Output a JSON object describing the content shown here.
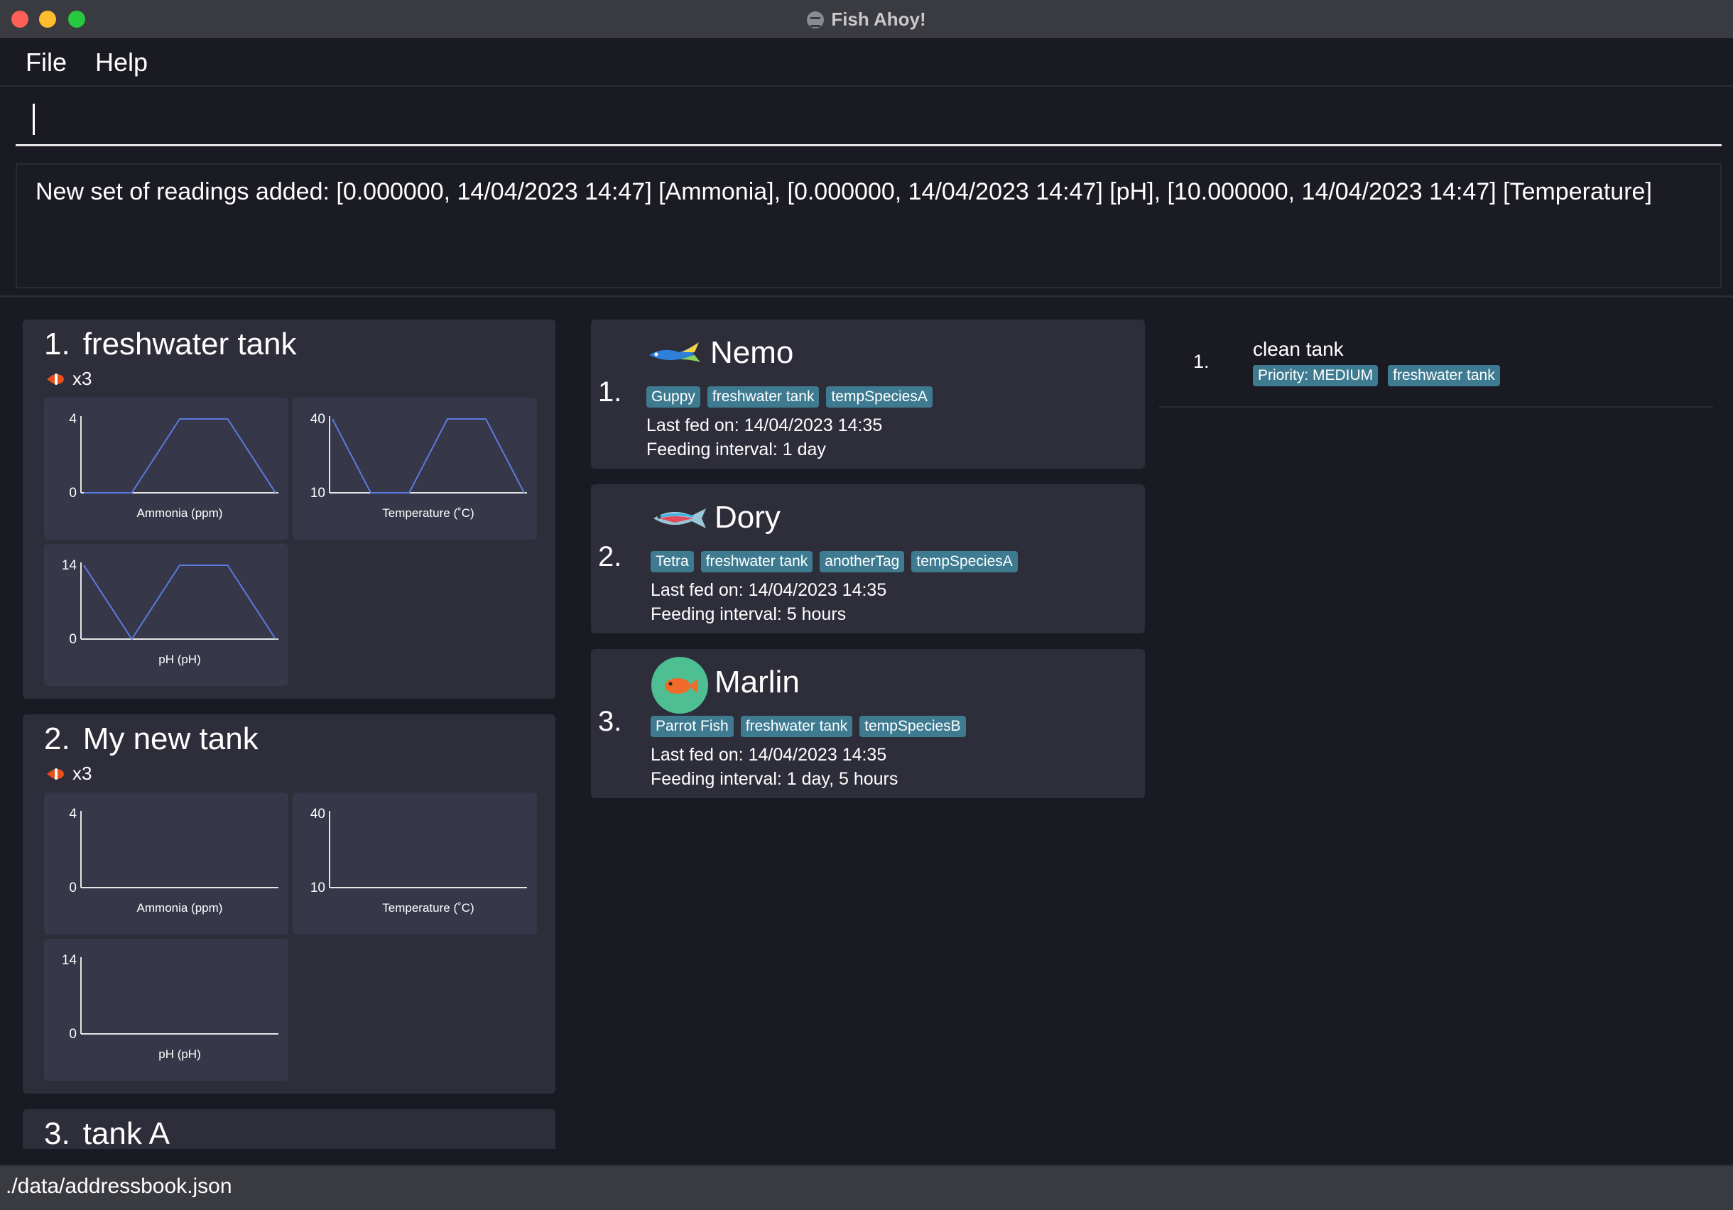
{
  "window": {
    "title": "Fish Ahoy!"
  },
  "menu": {
    "file": "File",
    "help": "Help"
  },
  "command": {
    "value": "",
    "placeholder": ""
  },
  "result": {
    "text": "New set of readings added: [0.000000, 14/04/2023 14:47] [Ammonia], [0.000000, 14/04/2023 14:47] [pH], [10.000000, 14/04/2023 14:47] [Temperature]"
  },
  "tanks": [
    {
      "index": "1.",
      "name": "freshwater tank",
      "fish_count": "x3",
      "charts": [
        {
          "label": "Ammonia (ppm)",
          "ymin": 0,
          "ymax": 4,
          "y_ticks": [
            "4",
            "0"
          ],
          "points": [
            0,
            0,
            4,
            4,
            0
          ]
        },
        {
          "label": "Temperature (˚C)",
          "ymin": 10,
          "ymax": 40,
          "y_ticks": [
            "40",
            "10"
          ],
          "points": [
            40,
            10,
            10,
            40,
            40,
            10
          ]
        },
        {
          "label": "pH (pH)",
          "ymin": 0,
          "ymax": 14,
          "y_ticks": [
            "14",
            "0"
          ],
          "points": [
            14,
            0,
            14,
            14,
            0
          ]
        }
      ]
    },
    {
      "index": "2.",
      "name": "My new tank",
      "fish_count": "x3",
      "charts": [
        {
          "label": "Ammonia (ppm)",
          "ymin": 0,
          "ymax": 4,
          "y_ticks": [
            "4",
            "0"
          ],
          "points": []
        },
        {
          "label": "Temperature (˚C)",
          "ymin": 10,
          "ymax": 40,
          "y_ticks": [
            "40",
            "10"
          ],
          "points": []
        },
        {
          "label": "pH (pH)",
          "ymin": 0,
          "ymax": 14,
          "y_ticks": [
            "14",
            "0"
          ],
          "points": []
        }
      ]
    },
    {
      "index": "3.",
      "name": "tank A",
      "fish_count": "",
      "charts": []
    }
  ],
  "fishes": [
    {
      "index": "1.",
      "name": "Nemo",
      "icon": "guppy-icon",
      "tags": [
        "Guppy",
        "freshwater tank",
        "tempSpeciesA"
      ],
      "last_fed": "Last fed on: 14/04/2023 14:35",
      "interval": "Feeding interval: 1 day"
    },
    {
      "index": "2.",
      "name": "Dory",
      "icon": "tetra-icon",
      "tags": [
        "Tetra",
        "freshwater tank",
        "anotherTag",
        "tempSpeciesA"
      ],
      "last_fed": "Last fed on: 14/04/2023 14:35",
      "interval": "Feeding interval: 5 hours"
    },
    {
      "index": "3.",
      "name": "Marlin",
      "icon": "parrot-fish-icon",
      "tags": [
        "Parrot Fish",
        "freshwater tank",
        "tempSpeciesB"
      ],
      "last_fed": "Last fed on: 14/04/2023 14:35",
      "interval": "Feeding interval: 1 day, 5 hours"
    }
  ],
  "tasks": [
    {
      "index": "1.",
      "name": "clean tank",
      "tags": [
        "Priority: MEDIUM",
        "freshwater tank"
      ]
    }
  ],
  "status": {
    "path": "./data/addressbook.json"
  },
  "colors": {
    "tag": "#3e7b91",
    "chart_line": "#5b7ae0",
    "card": "#2d2e3a"
  }
}
